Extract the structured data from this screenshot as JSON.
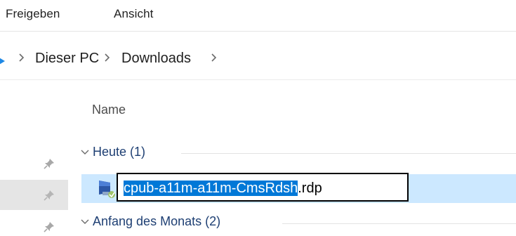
{
  "ribbon": {
    "tabs": [
      {
        "label": "Freigeben"
      },
      {
        "label": "Ansicht"
      }
    ]
  },
  "address_bar": {
    "breadcrumbs": [
      {
        "label": "Dieser PC"
      },
      {
        "label": "Downloads"
      }
    ],
    "icons": {
      "separator": "chevron-right-icon",
      "nav": "nav-arrow-icon"
    }
  },
  "file_list": {
    "column_header": "Name",
    "groups": [
      {
        "label": "Heute (1)",
        "items": [
          {
            "name_selected": "cpub-a11m-a11m-CmsRdsh",
            "name_extension": ".rdp",
            "icon": "remote-desktop-file-icon",
            "state": "renaming"
          }
        ]
      },
      {
        "label": "Anfang des Monats (2)",
        "items": []
      }
    ]
  },
  "sidebar": {
    "pin_icon": "pin-icon"
  },
  "colors": {
    "selection_row": "#cce8ff",
    "text_selection": "#0078d7",
    "group_label": "#1e3f73",
    "nav_accent": "#1e88e5"
  }
}
